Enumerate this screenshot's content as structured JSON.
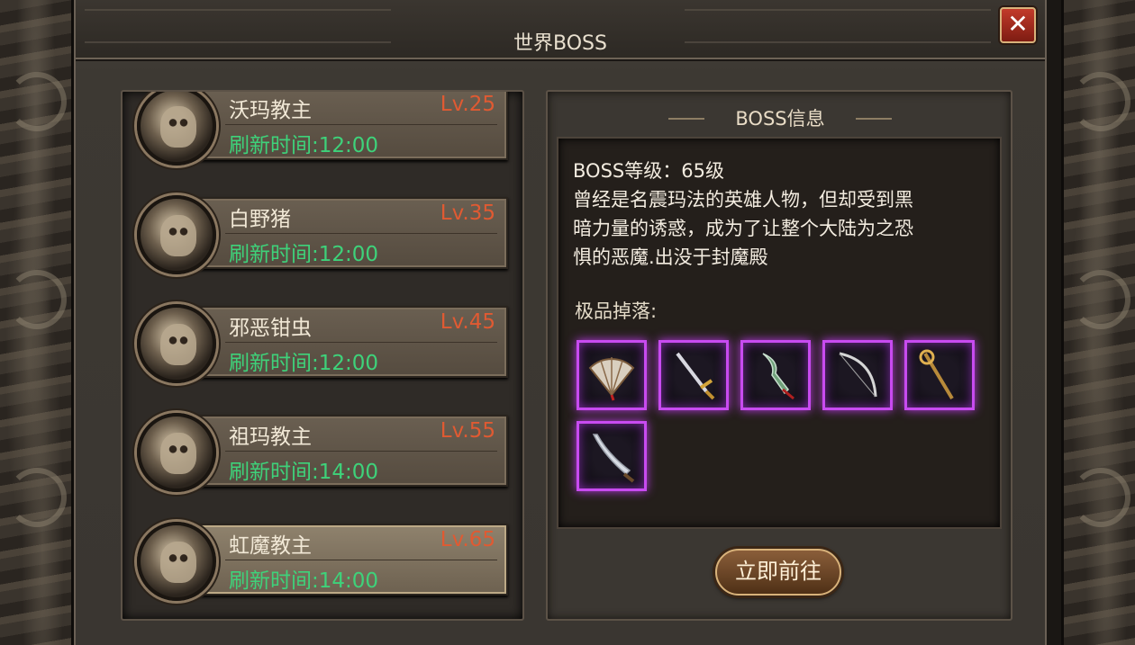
{
  "window": {
    "title": "世界BOSS"
  },
  "bosses": [
    {
      "name": "沃玛教主",
      "level": "Lv.25",
      "refresh": "刷新时间:12:00"
    },
    {
      "name": "白野猪",
      "level": "Lv.35",
      "refresh": "刷新时间:12:00"
    },
    {
      "name": "邪恶钳虫",
      "level": "Lv.45",
      "refresh": "刷新时间:12:00"
    },
    {
      "name": "祖玛教主",
      "level": "Lv.55",
      "refresh": "刷新时间:14:00"
    },
    {
      "name": "虹魔教主",
      "level": "Lv.65",
      "refresh": "刷新时间:14:00",
      "selected": true
    }
  ],
  "info": {
    "header": "BOSS信息",
    "level_line": "BOSS等级：65级",
    "description_lines": [
      "曾经是名震玛法的英雄人物，但却受到黑",
      "暗力量的诱惑，成为了让整个大陆为之恐",
      "惧的恶魔.出没于封魔殿"
    ],
    "drops_title": "极品掉落:",
    "drop_items": [
      "fan-icon",
      "sword-icon",
      "blade-icon",
      "bow-icon",
      "staff-icon",
      "saber-icon"
    ],
    "go_button": "立即前往"
  },
  "colors": {
    "level": "#e05a32",
    "refresh": "#3ed27a",
    "drop_border": "#c84bf0"
  }
}
